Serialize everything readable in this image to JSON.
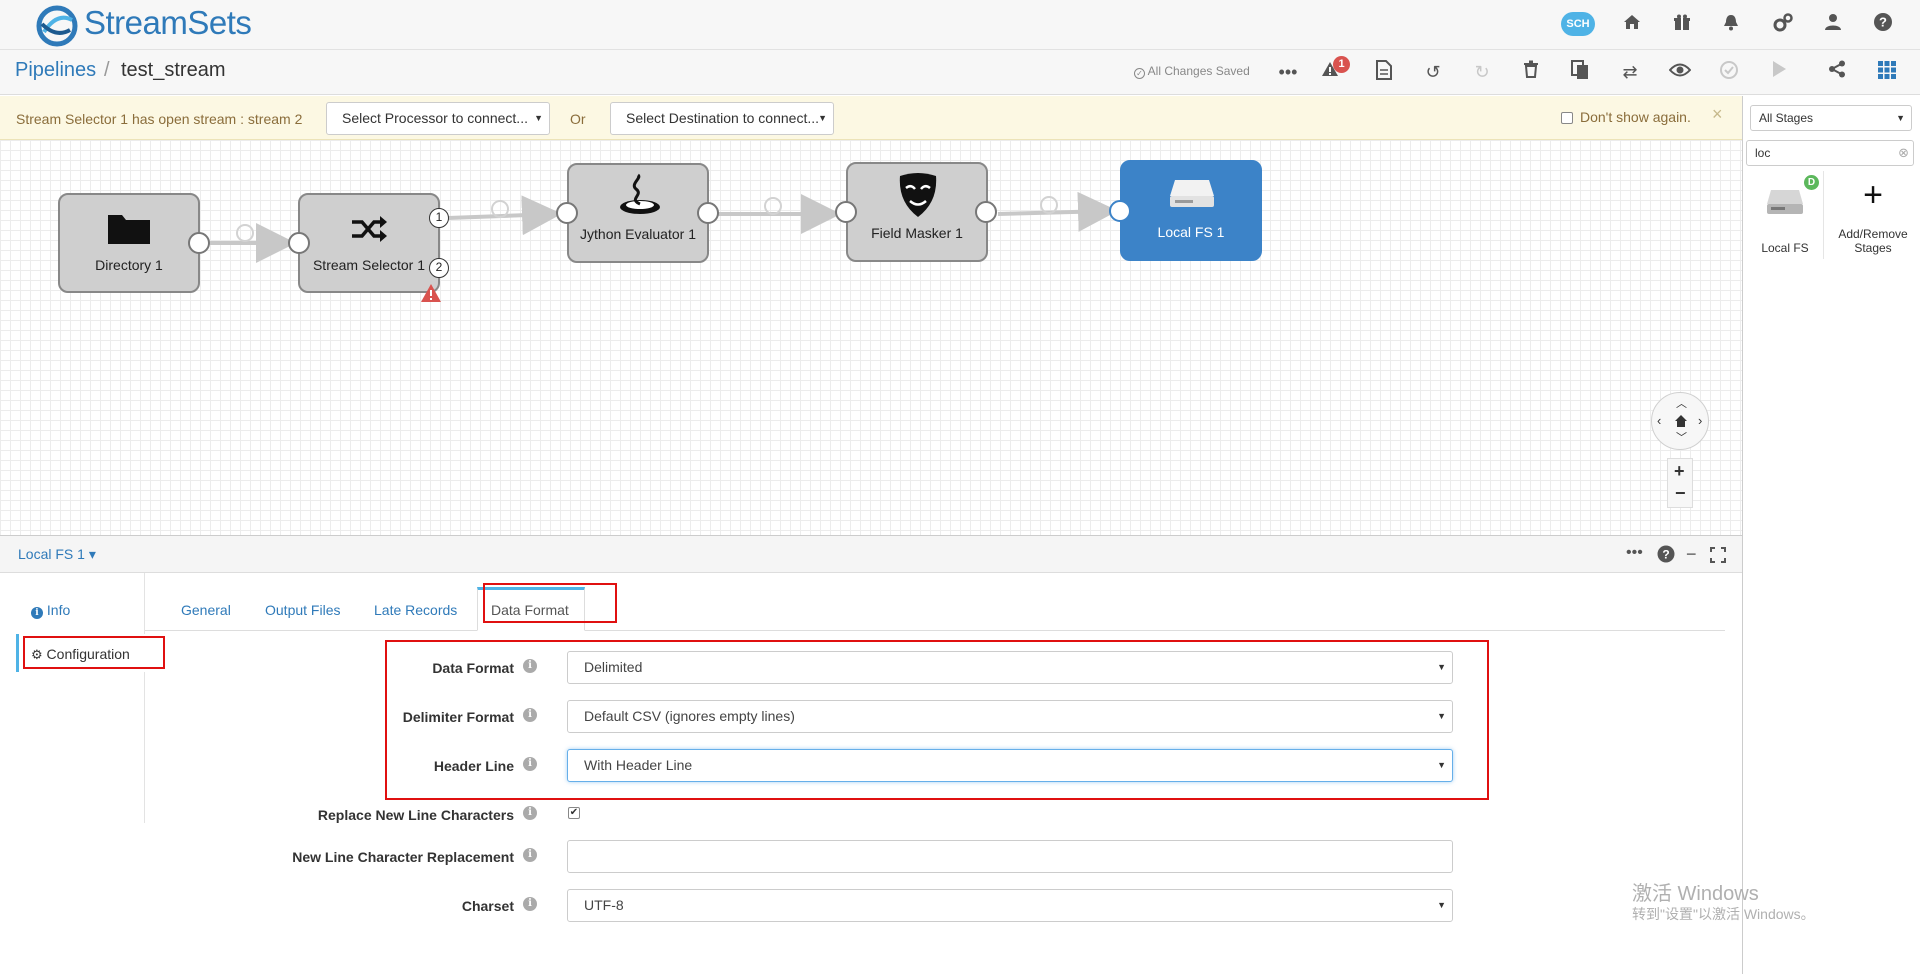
{
  "app": {
    "name": "StreamSets",
    "sch_badge": "SCH"
  },
  "colors": {
    "brand": "#2f7ab9",
    "selected_stage": "#3c83c8",
    "warning_bg": "#fcf8e3",
    "highlight": "#e01010",
    "alert": "#d9534f",
    "data_collector_badge": "#5cb85c"
  },
  "top_icons": [
    "sch-cloud-icon",
    "home-icon",
    "gift-icon",
    "bell-icon",
    "gears-icon",
    "user-icon",
    "help-icon"
  ],
  "breadcrumb": {
    "root": "Pipelines",
    "separator": "/",
    "pipeline": "test_stream"
  },
  "toolbar": {
    "status": "All Changes Saved",
    "alert_count": "1",
    "icons": [
      "more-icon",
      "alert-icon",
      "document-icon",
      "undo-icon",
      "redo-icon",
      "delete-icon",
      "copy-icon",
      "shuffle-icon",
      "preview-icon",
      "validate-icon",
      "start-icon",
      "share-icon",
      "grid-icon"
    ]
  },
  "warning": {
    "message": "Stream Selector 1 has open stream : stream 2",
    "processor_select": "Select Processor to connect...",
    "or": "Or",
    "destination_select": "Select Destination to connect...",
    "dont_show": "Don't show again.",
    "close": "×"
  },
  "pipeline": {
    "stages": [
      {
        "label": "Directory 1",
        "icon": "folder-icon"
      },
      {
        "label": "Stream Selector 1",
        "icon": "shuffle-icon",
        "output_ports": [
          "1",
          "2"
        ],
        "has_error": true
      },
      {
        "label": "Jython Evaluator 1",
        "icon": "python-icon"
      },
      {
        "label": "Field Masker 1",
        "icon": "mask-icon"
      },
      {
        "label": "Local FS 1",
        "icon": "hard-drive-icon",
        "selected": true
      }
    ]
  },
  "stage_library": {
    "filter": "All Stages",
    "search_value": "loc",
    "tiles": [
      {
        "label": "Local FS",
        "badge": "D"
      },
      {
        "label": "Add/Remove Stages",
        "icon": "plus-icon"
      }
    ]
  },
  "bottom": {
    "stage_name": "Local FS 1 ▾",
    "left_nav": [
      {
        "label": "Info"
      },
      {
        "label": "Configuration"
      }
    ],
    "tabs": [
      "General",
      "Output Files",
      "Late Records",
      "Data Format"
    ],
    "active_tab": "Data Format",
    "fields": [
      {
        "label": "Data Format",
        "value": "Delimited",
        "type": "select"
      },
      {
        "label": "Delimiter Format",
        "value": "Default CSV (ignores empty lines)",
        "type": "select"
      },
      {
        "label": "Header Line",
        "value": "With Header Line",
        "type": "select"
      },
      {
        "label": "Replace New Line Characters",
        "value": "checked",
        "type": "checkbox"
      },
      {
        "label": "New Line Character Replacement",
        "value": "",
        "type": "text"
      },
      {
        "label": "Charset",
        "value": "UTF-8",
        "type": "select"
      }
    ]
  },
  "watermark": {
    "line1": "激活 Windows",
    "line2": "转到\"设置\"以激活 Windows。"
  }
}
